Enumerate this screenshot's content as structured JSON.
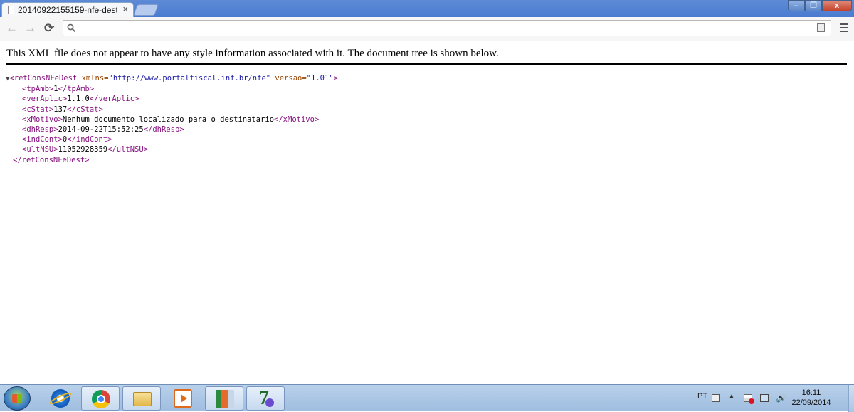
{
  "browser": {
    "tab_title": "20140922155159-nfe-dest.",
    "tab_close": "×",
    "address_value": "",
    "address_placeholder": "",
    "window_controls": {
      "minimize": "–",
      "maximize": "❐",
      "close": "x"
    },
    "nav": {
      "back": "←",
      "forward": "→",
      "reload": "⟳"
    }
  },
  "page": {
    "info_message": "This XML file does not appear to have any style information associated with it. The document tree is shown below.",
    "xml": {
      "toggle": "▼",
      "root_open": "<retConsNFeDest",
      "attr1_name": " xmlns=",
      "attr1_value": "\"http://www.portalfiscal.inf.br/nfe\"",
      "attr2_name": " versao=",
      "attr2_value": "\"1.01\"",
      "root_gt": ">",
      "children": [
        {
          "open": "<tpAmb>",
          "value": "1",
          "close": "</tpAmb>"
        },
        {
          "open": "<verAplic>",
          "value": "1.1.0",
          "close": "</verAplic>"
        },
        {
          "open": "<cStat>",
          "value": "137",
          "close": "</cStat>"
        },
        {
          "open": "<xMotivo>",
          "value": "Nenhum documento localizado para o destinatario",
          "close": "</xMotivo>"
        },
        {
          "open": "<dhResp>",
          "value": "2014-09-22T15:52:25",
          "close": "</dhResp>"
        },
        {
          "open": "<indCont>",
          "value": "0",
          "close": "</indCont>"
        },
        {
          "open": "<ultNSU>",
          "value": "11052928359",
          "close": "</ultNSU>"
        }
      ],
      "root_close": "</retConsNFeDest>"
    }
  },
  "taskbar": {
    "language": "PT",
    "tray_arrow": "▲",
    "volume": "🔊",
    "time": "16:11",
    "date": "22/09/2014"
  },
  "colors": {
    "tag": "#881280",
    "attribute_name": "#994500",
    "attribute_value": "#1a1aa6",
    "titlebar": "#4a7bd0"
  }
}
